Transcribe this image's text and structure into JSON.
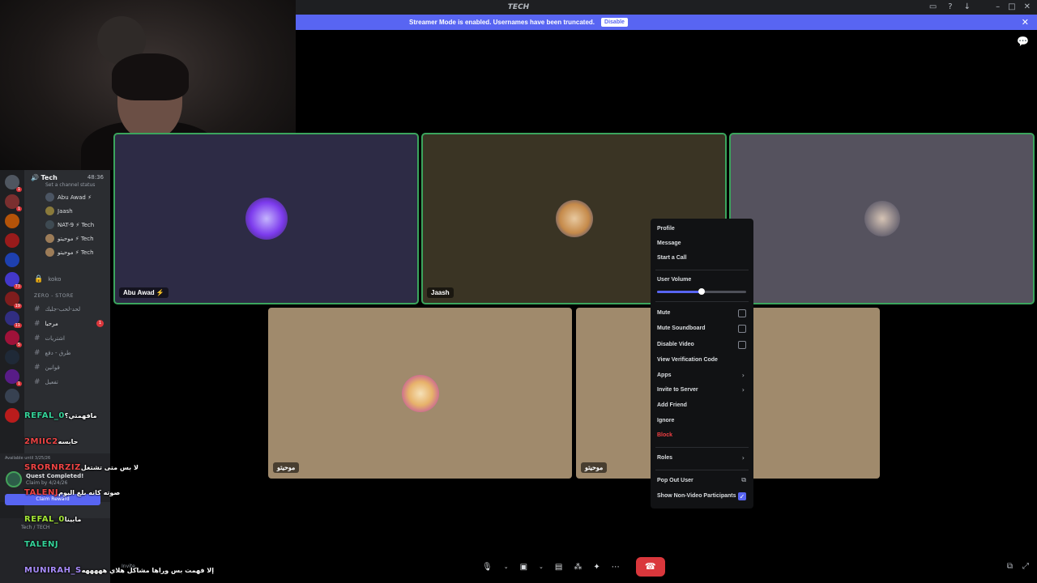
{
  "window": {
    "title": "TECH"
  },
  "banner": {
    "message": "Streamer Mode is enabled. Usernames have been truncated.",
    "action_label": "Disable"
  },
  "sidebar": {
    "voice_channel": {
      "name": "Tech",
      "timer": "48:36",
      "status_placeholder": "Set a channel status"
    },
    "voice_members": [
      {
        "name": "Abu Awad ⚡",
        "avatar_color": "#4b5563"
      },
      {
        "name": "Jaash",
        "avatar_color": "#8a7a3b"
      },
      {
        "name": "NAT-9 ⚡ Tech",
        "avatar_color": "#3e4a52"
      },
      {
        "name": "موحيتو ⚡ Tech",
        "avatar_color": "#9c7c58"
      },
      {
        "name": "موحيتو ⚡ Tech",
        "avatar_color": "#9c7c58"
      }
    ],
    "locked_channel": "koko",
    "category": "ZERO - STORE",
    "text_channels": [
      {
        "name": "لحد-لحب-جلبك",
        "badge": ""
      },
      {
        "name": "مرحبا",
        "badge": "1"
      },
      {
        "name": "اشتريات",
        "badge": ""
      },
      {
        "name": "طرق - دفع",
        "badge": ""
      },
      {
        "name": "قوانين",
        "badge": ""
      },
      {
        "name": "تفعيل",
        "badge": ""
      }
    ],
    "quest": {
      "available": "Available until 3/25/26",
      "title": "Quest Completed!",
      "subtitle": "Claim by 4/24/26",
      "button": "Claim Reward"
    },
    "user_status": "Tech / TECH",
    "invite_label": "Invite"
  },
  "tiles": [
    {
      "name": "Abu Awad ⚡",
      "bg": "#2d2b45"
    },
    {
      "name": "Jaash",
      "bg": "#3a3424"
    },
    {
      "name": "",
      "bg": "#55525e"
    },
    {
      "name": "موحيتو",
      "bg": "#a08a6c"
    },
    {
      "name": "موحيتو",
      "bg": "#a08a6c"
    }
  ],
  "context_menu": {
    "profile": "Profile",
    "message": "Message",
    "start_call": "Start a Call",
    "user_volume": "User Volume",
    "volume_level": 0.5,
    "mute": "Mute",
    "mute_soundboard": "Mute Soundboard",
    "disable_video": "Disable Video",
    "view_verification": "View Verification Code",
    "apps": "Apps",
    "invite_to_server": "Invite to Server",
    "add_friend": "Add Friend",
    "ignore": "Ignore",
    "block": "Block",
    "roles": "Roles",
    "pop_out_user": "Pop Out User",
    "show_non_video": "Show Non-Video Participants"
  },
  "chat_overlay": [
    {
      "user": "REFAL_0",
      "user_color": "#34d399",
      "text": "مافهمتي؟"
    },
    {
      "user": "2MIIC2",
      "user_color": "#ef4444",
      "text": "حابسه"
    },
    {
      "user": "SRORNRZIZ",
      "user_color": "#ef4444",
      "text": "لا بس متى تشتغل"
    },
    {
      "user": "TALENJ",
      "user_color": "#ef4444",
      "text": "صوته كانه بلغ اليوم"
    },
    {
      "user": "REFAL_0",
      "user_color": "#a3e635",
      "text": "مابينا"
    },
    {
      "user": "TALENJ",
      "user_color": "#34d399",
      "text": ""
    },
    {
      "user": "MUNIRAH_S",
      "user_color": "#a78bfa",
      "text": "إلا فهمت بس وراها مشاكل هلاي هههههه"
    }
  ]
}
